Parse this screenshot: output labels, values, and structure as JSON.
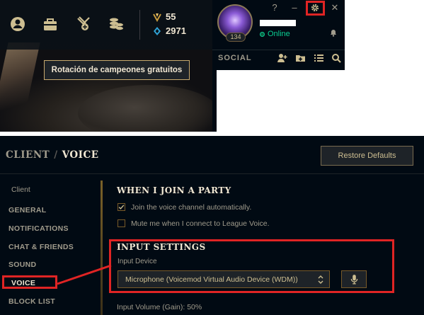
{
  "client": {
    "currency": {
      "blue_essence": "55",
      "riot_points": "2971"
    },
    "rotation_button": "Rotación de campeones gratuitos",
    "profile": {
      "level": "134",
      "status": "Online"
    },
    "window_controls": {
      "help": "?",
      "minimize": "–",
      "close": "✕"
    },
    "social": {
      "title": "SOCIAL"
    }
  },
  "voice_settings": {
    "breadcrumb": {
      "section": "CLIENT",
      "separator": "/",
      "page": "VOICE"
    },
    "restore_defaults": "Restore Defaults",
    "sidebar": {
      "heading": "Client",
      "items": [
        {
          "label": "GENERAL"
        },
        {
          "label": "NOTIFICATIONS"
        },
        {
          "label": "CHAT & FRIENDS"
        },
        {
          "label": "SOUND"
        },
        {
          "label": "VOICE",
          "active": true
        },
        {
          "label": "BLOCK LIST"
        }
      ]
    },
    "party": {
      "title": "WHEN I JOIN A PARTY",
      "options": [
        {
          "label": "Join the voice channel automatically.",
          "checked": true
        },
        {
          "label": "Mute me when I connect to League Voice.",
          "checked": false
        }
      ]
    },
    "input": {
      "title": "INPUT SETTINGS",
      "device_label": "Input Device",
      "device_value": "Microphone (Voicemod Virtual Audio Device (WDM))",
      "volume_label": "Input Volume (Gain): 50%"
    }
  },
  "colors": {
    "gold": "#c8aa6e",
    "highlight": "#e02424",
    "online": "#0acd92",
    "panel": "#010a13"
  }
}
